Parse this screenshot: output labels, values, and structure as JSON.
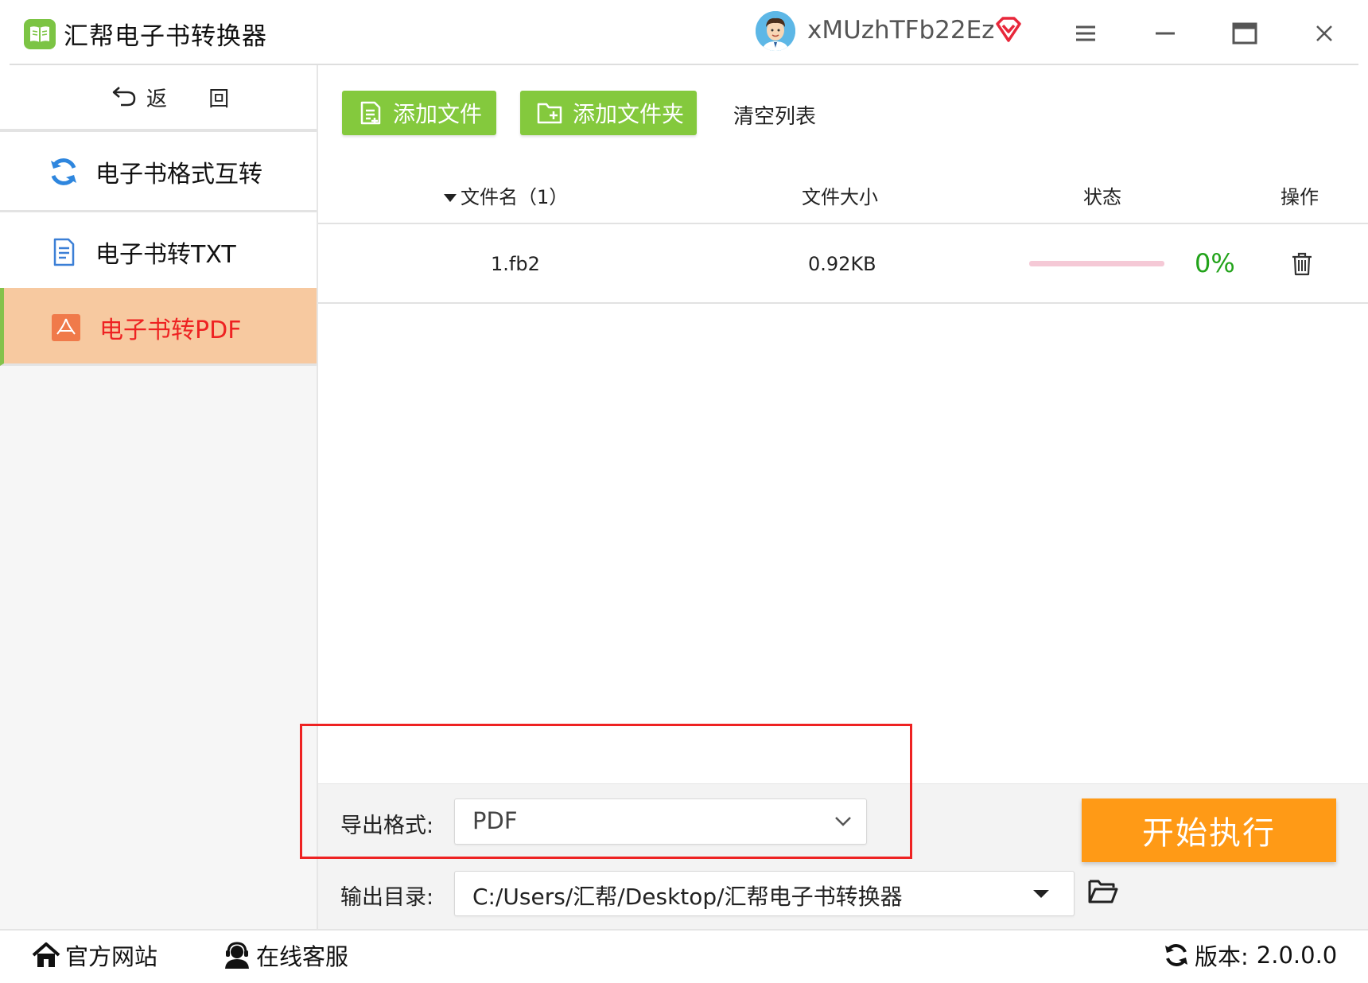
{
  "app": {
    "title": "汇帮电子书转换器",
    "username": "xMUzhTFb22Ez",
    "brand_color": "#84c93d",
    "icons": [
      "book-icon",
      "avatar",
      "vip-diamond-icon",
      "menu-icon",
      "minimize-icon",
      "maximize-icon",
      "close-icon"
    ]
  },
  "sidebar": {
    "back_label": "返 回",
    "items": [
      {
        "label": "电子书格式互转",
        "icon": "refresh-icon",
        "active": false
      },
      {
        "label": "电子书转TXT",
        "icon": "txt-document-icon",
        "active": false
      },
      {
        "label": "电子书转PDF",
        "icon": "pdf-icon",
        "active": true
      }
    ],
    "active_bg": "#f7c9a0",
    "active_text_color": "#ee2222"
  },
  "toolbar": {
    "add_file_label": "添加文件",
    "add_folder_label": "添加文件夹",
    "clear_label": "清空列表"
  },
  "table": {
    "columns": {
      "name": "文件名（1）",
      "size": "文件大小",
      "status": "状态",
      "action": "操作"
    },
    "rows": [
      {
        "name": "1.fb2",
        "size": "0.92KB",
        "progress": 0,
        "progress_text": "0%",
        "action_icon": "trash-icon"
      }
    ]
  },
  "settings": {
    "format_label": "导出格式:",
    "format_value": "PDF",
    "output_label": "输出目录:",
    "output_value": "C:/Users/汇帮/Desktop/汇帮电子书转换器",
    "start_label": "开始执行",
    "start_color": "#ff9a16",
    "highlight_color": "#ee2222"
  },
  "footer": {
    "website_label": "官方网站",
    "support_label": "在线客服",
    "version_label": "版本:",
    "version_value": "2.0.0.0"
  }
}
